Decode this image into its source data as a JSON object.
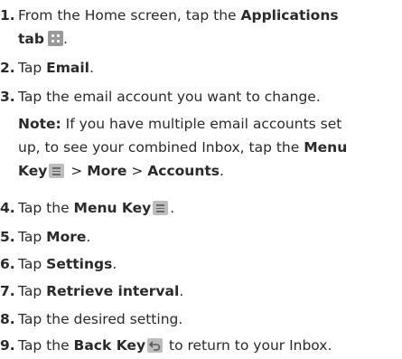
{
  "steps": [
    {
      "num": "1.",
      "parts": [
        "From the Home screen, tap the ",
        "Applications",
        "tab"
      ]
    },
    {
      "num": "2.",
      "parts": [
        "Tap ",
        "Email",
        "."
      ]
    },
    {
      "num": "3.",
      "parts": [
        "Tap the email account you want to change."
      ]
    },
    {
      "num": "4.",
      "parts": [
        "Tap the ",
        "Menu Key",
        "."
      ]
    },
    {
      "num": "5.",
      "parts": [
        "Tap ",
        "More",
        "."
      ]
    },
    {
      "num": "6.",
      "parts": [
        "Tap ",
        "Settings",
        "."
      ]
    },
    {
      "num": "7.",
      "parts": [
        "Tap ",
        "Retrieve interval",
        "."
      ]
    },
    {
      "num": "8.",
      "parts": [
        "Tap the desired setting."
      ]
    },
    {
      "num": "9.",
      "parts": [
        "Tap the ",
        "Back Key",
        " to return to your Inbox."
      ]
    }
  ],
  "note": {
    "label": "Note:",
    "line1": " If you have multiple email accounts set",
    "line2_a": "up, to see your combined Inbox, tap the ",
    "line2_b": "Menu",
    "line3_a": "Key",
    "line3_b": " > ",
    "line3_c": "More",
    "line3_d": " > ",
    "line3_e": "Accounts",
    "line3_f": "."
  },
  "icons": {
    "applications_tab": "applications-grid-icon",
    "menu_key": "menu-key-icon",
    "back_key": "back-key-icon"
  },
  "colors": {
    "text": "#2a2a2a",
    "icon_bg": "#bdbdbd",
    "apps_icon_bg": "#9a9a9a"
  }
}
